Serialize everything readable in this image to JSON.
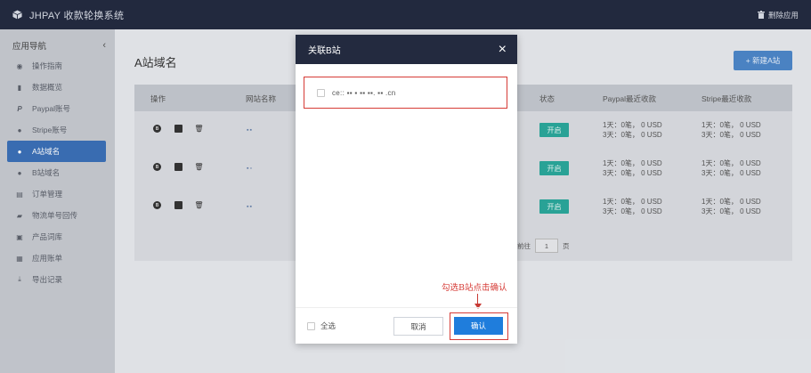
{
  "topbar": {
    "brand": "JHPAY 收款轮换系统",
    "logo_icon": "cube-icon",
    "delete_app_label": "删除应用",
    "delete_icon": "trash-icon"
  },
  "sidebar": {
    "header": "应用导航",
    "collapse_icon": "chevron-left-icon",
    "items": [
      {
        "label": "操作指南",
        "icon": "compass-icon"
      },
      {
        "label": "数据概览",
        "icon": "bar-chart-icon"
      },
      {
        "label": "Paypal账号",
        "icon": "paypal-icon"
      },
      {
        "label": "Stripe账号",
        "icon": "stripe-icon"
      },
      {
        "label": "A站域名",
        "icon": "a-badge-icon",
        "active": true
      },
      {
        "label": "B站域名",
        "icon": "b-badge-icon"
      },
      {
        "label": "订单管理",
        "icon": "order-icon"
      },
      {
        "label": "物流单号回传",
        "icon": "truck-icon"
      },
      {
        "label": "产品词库",
        "icon": "product-icon"
      },
      {
        "label": "应用账单",
        "icon": "bill-icon"
      },
      {
        "label": "导出记录",
        "icon": "export-icon"
      }
    ]
  },
  "main": {
    "title": "A站域名",
    "new_button": "+ 新建A站",
    "table": {
      "headers": {
        "action": "操作",
        "site": "网站名称",
        "status": "状态",
        "paypal": "Paypal最近收款",
        "stripe": "Stripe最近收款"
      },
      "rows": [
        {
          "site": "▪▪",
          "status": "开启",
          "paypal_1": "1天：0笔， 0 USD",
          "paypal_3": "3天：0笔， 0 USD",
          "stripe_1": "1天：0笔， 0 USD",
          "stripe_3": "3天：0笔， 0 USD"
        },
        {
          "site": "▪▫",
          "status": "开启",
          "paypal_1": "1天：0笔， 0 USD",
          "paypal_3": "3天：0笔， 0 USD",
          "stripe_1": "1天：0笔， 0 USD",
          "stripe_3": "3天：0笔， 0 USD"
        },
        {
          "site": "▪▪",
          "status": "开启",
          "paypal_1": "1天：0笔， 0 USD",
          "paypal_3": "3天：0笔， 0 USD",
          "stripe_1": "1天：0笔， 0 USD",
          "stripe_3": "3天：0笔， 0 USD"
        }
      ],
      "row_actions": [
        "b-circle-icon",
        "save-icon",
        "trash-icon"
      ]
    },
    "pager": {
      "goto": "前往",
      "page": "1",
      "unit": "页"
    }
  },
  "modal": {
    "title": "关联B站",
    "close": "×",
    "item_label": "ce:: ▪▪ ▪ ▪▪ ▪▪. ▪▪ .cn",
    "annotation": "勾选B站点击确认",
    "select_all": "全选",
    "cancel": "取消",
    "confirm": "确认"
  },
  "colors": {
    "topbar": "#232a3f",
    "sidebar_active": "#3a6fb6",
    "status_on": "#2aa79a",
    "confirm": "#1f7ddc",
    "annotation_red": "#d63b36"
  }
}
